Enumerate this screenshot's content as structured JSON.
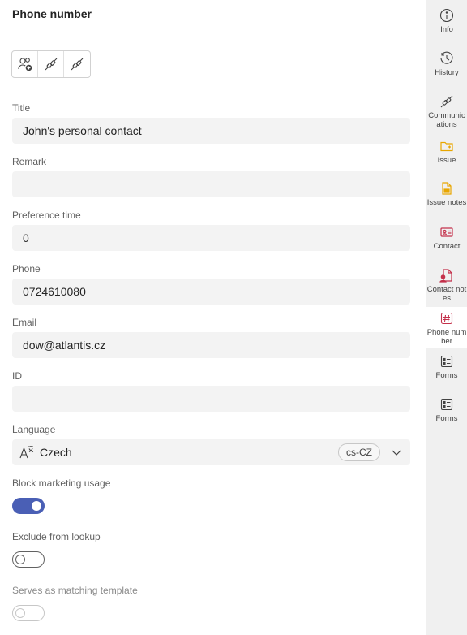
{
  "page": {
    "title": "Phone number"
  },
  "toolbar": {
    "icons": [
      "add-contact-icon",
      "unlink-icon",
      "unlink-icon"
    ]
  },
  "fields": {
    "title": {
      "label": "Title",
      "value": "John's personal contact"
    },
    "remark": {
      "label": "Remark",
      "value": ""
    },
    "preference_time": {
      "label": "Preference time",
      "value": "0"
    },
    "phone": {
      "label": "Phone",
      "value": "0724610080"
    },
    "email": {
      "label": "Email",
      "value": "dow@atlantis.cz"
    },
    "id": {
      "label": "ID",
      "value": ""
    }
  },
  "language": {
    "label": "Language",
    "value": "Czech",
    "code": "cs-CZ"
  },
  "toggles": {
    "block_marketing": {
      "label": "Block marketing usage",
      "on": true
    },
    "exclude_lookup": {
      "label": "Exclude from lookup",
      "on": false
    },
    "matching_template": {
      "label": "Serves as matching template",
      "on": false,
      "disabled": true
    }
  },
  "rail": {
    "items": [
      {
        "label": "Info",
        "icon": "info-icon",
        "color": "#424242"
      },
      {
        "label": "History",
        "icon": "history-icon",
        "color": "#424242"
      },
      {
        "label": "Communications",
        "icon": "unlink-icon",
        "color": "#424242"
      },
      {
        "label": "Issue",
        "icon": "folder-icon",
        "color": "#e8a600"
      },
      {
        "label": "Issue notes",
        "icon": "note-icon",
        "color": "#e8a600"
      },
      {
        "label": "Contact",
        "icon": "contact-card-icon",
        "color": "#c4314b"
      },
      {
        "label": "Contact notes",
        "icon": "contact-note-icon",
        "color": "#c4314b"
      },
      {
        "label": "Phone number",
        "icon": "hash-icon",
        "color": "#c4314b"
      },
      {
        "label": "Forms",
        "icon": "form-icon",
        "color": "#424242"
      },
      {
        "label": "Forms",
        "icon": "form-icon",
        "color": "#424242"
      }
    ]
  },
  "colors": {
    "accent": "#4a5fb5",
    "issue": "#e8a600",
    "contact": "#c4314b"
  }
}
